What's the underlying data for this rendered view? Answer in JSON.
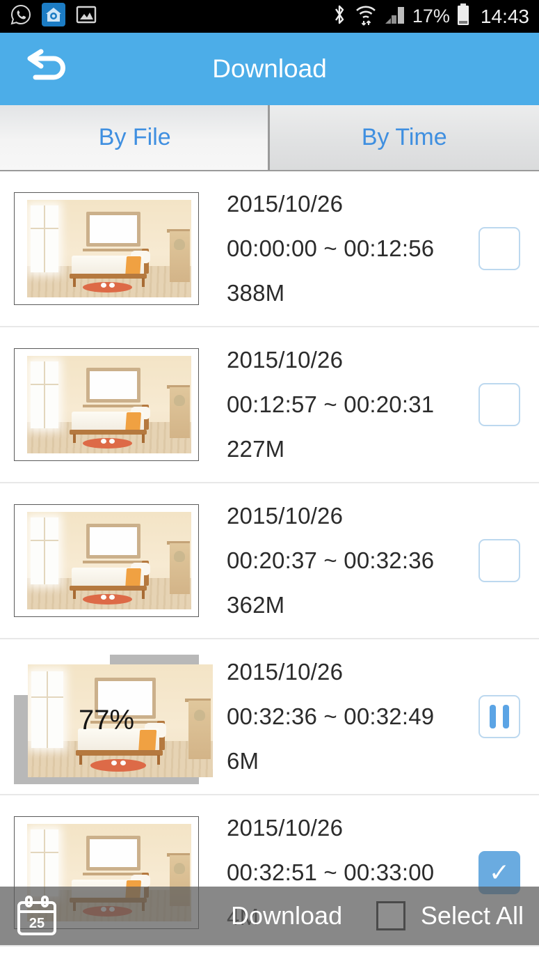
{
  "statusbar": {
    "icons": [
      "whatsapp-icon",
      "home-camera-icon",
      "gallery-icon",
      "bluetooth-icon",
      "wifi-icon",
      "signal-icon"
    ],
    "battery_percent": "17%",
    "time": "14:43"
  },
  "header": {
    "title": "Download",
    "back_icon": "back-arrow-icon",
    "background_color": "#4cade8"
  },
  "tabs": [
    {
      "label": "By File",
      "active": true
    },
    {
      "label": "By Time",
      "active": false
    }
  ],
  "list": [
    {
      "date": "2015/10/26",
      "time_range": "00:00:00 ~ 00:12:56",
      "size": "388M",
      "state": "unchecked",
      "action_icon": "checkbox-empty-icon"
    },
    {
      "date": "2015/10/26",
      "time_range": "00:12:57 ~ 00:20:31",
      "size": "227M",
      "state": "unchecked",
      "action_icon": "checkbox-empty-icon"
    },
    {
      "date": "2015/10/26",
      "time_range": "00:20:37 ~ 00:32:36",
      "size": "362M",
      "state": "unchecked",
      "action_icon": "checkbox-empty-icon"
    },
    {
      "date": "2015/10/26",
      "time_range": "00:32:36 ~ 00:32:49",
      "size": "6M",
      "state": "downloading",
      "progress": "77%",
      "progress_value": 77,
      "action_icon": "pause-icon"
    },
    {
      "date": "2015/10/26",
      "time_range": "00:32:51 ~ 00:33:00",
      "size": "4M",
      "state": "checked",
      "action_icon": "checkbox-checked-icon"
    }
  ],
  "bottombar": {
    "calendar_icon": "calendar-icon",
    "calendar_day": "25",
    "download_label": "Download",
    "select_all_label": "Select All",
    "select_all_checked": false
  },
  "colors": {
    "accent_blue": "#4cade8",
    "tab_text": "#3f8fe0",
    "checkbox_checked": "#6aabe0",
    "status_bg": "#000000"
  }
}
